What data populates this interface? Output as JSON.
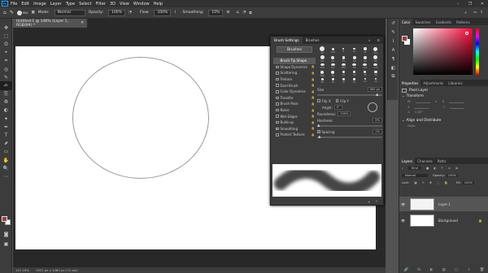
{
  "menu": [
    "File",
    "Edit",
    "Image",
    "Layer",
    "Type",
    "Select",
    "Filter",
    "3D",
    "View",
    "Window",
    "Help"
  ],
  "app_logo": "Ps",
  "window_controls": [
    "–",
    "❐",
    "✕"
  ],
  "options": {
    "mode_label": "Mode:",
    "mode_value": "Normal",
    "opacity_label": "Opacity:",
    "opacity_value": "100%",
    "flow_label": "Flow:",
    "flow_value": "100%",
    "smoothing_label": "Smoothing:",
    "smoothing_value": "10%",
    "brush_size": "900"
  },
  "tools": [
    "✥",
    "⬚",
    "ʘ",
    "⌖",
    "⌗",
    "◎",
    "✎",
    "✍",
    "⎘",
    "♻",
    "◐",
    "✦",
    "✒",
    "T",
    "⬈",
    "▭",
    "✋",
    "🔍",
    "⋯"
  ],
  "document": {
    "tab_title": "Untitled-1 @ 146% (Layer 1, RGB/8#) *",
    "close": "✕"
  },
  "status": {
    "zoom": "147.16%",
    "size": "1921 px x 1080 px (72 ppi)"
  },
  "brush_settings": {
    "tabs": [
      "Brush Settings",
      "Brushes"
    ],
    "brushes_button": "Brushes",
    "options": [
      {
        "label": "Brush Tip Shape",
        "checked": false,
        "selected": true
      },
      {
        "label": "Shape Dynamics",
        "checked": false
      },
      {
        "label": "Scattering",
        "checked": false
      },
      {
        "label": "Texture",
        "checked": false
      },
      {
        "label": "Dual Brush",
        "checked": false
      },
      {
        "label": "Color Dynamics",
        "checked": false
      },
      {
        "label": "Transfer",
        "checked": false
      },
      {
        "label": "Brush Pose",
        "checked": false
      },
      {
        "label": "Noise",
        "checked": false
      },
      {
        "label": "Wet Edges",
        "checked": false
      },
      {
        "label": "Build-up",
        "checked": false
      },
      {
        "label": "Smoothing",
        "checked": true
      },
      {
        "label": "Protect Texture",
        "checked": false
      }
    ],
    "tips": [
      "30",
      "123",
      "8",
      "10",
      "25",
      "112",
      "60",
      "50",
      "25",
      "30",
      "50",
      "60",
      "100",
      "127",
      "284",
      "80",
      "174",
      "175",
      "306",
      "50",
      "25",
      "36",
      "36",
      "36",
      "36",
      "36",
      "32",
      "25",
      "14",
      "24"
    ],
    "size_label": "Size",
    "size_value": "900 px",
    "flip_x": "Flip X",
    "flip_y": "Flip Y",
    "angle_label": "Angle:",
    "angle_value": "0°",
    "roundness_label": "Roundness:",
    "roundness_value": "100%",
    "hardness_label": "Hardness",
    "hardness_value": "0%",
    "spacing_label": "Spacing",
    "spacing_value": "1%"
  },
  "color_panel": {
    "tabs": [
      "Color",
      "Swatches",
      "Gradients",
      "Patterns"
    ]
  },
  "properties": {
    "tabs": [
      "Properties",
      "Adjustments",
      "Libraries"
    ],
    "kind": "Pixel Layer",
    "transform": "Transform",
    "w": "W",
    "h": "H",
    "x": "X",
    "y": "Y",
    "angle": "0.00°",
    "align": "Align and Distribute",
    "align_sub": "Align:"
  },
  "layers": {
    "tabs": [
      "Layers",
      "Channels",
      "Paths"
    ],
    "kind_label": "Kind",
    "blend": "Normal",
    "opacity_label": "Opacity:",
    "opacity": "100%",
    "lock_label": "Lock:",
    "fill_label": "Fill:",
    "fill": "100%",
    "items": [
      {
        "name": "Layer 1",
        "selected": true
      },
      {
        "name": "Background",
        "selected": false
      }
    ],
    "footer_icons": [
      "🔗",
      "fx",
      "◐",
      "▤",
      "▢",
      "＋",
      "🗑"
    ]
  }
}
